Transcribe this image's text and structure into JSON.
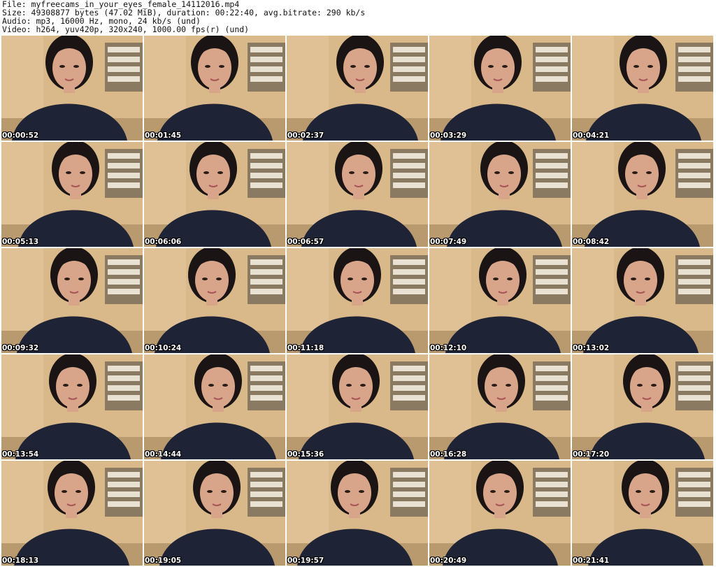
{
  "header": {
    "file": "File: myfreecams_in_your_eyes_female_14112016.mp4",
    "size": "Size: 49308877 bytes (47.02 MiB), duration: 00:22:40, avg.bitrate: 290 kb/s",
    "audio": "Audio: mp3, 16000 Hz, mono, 24 kb/s (und)",
    "video": "Video: h264, yuv420p, 320x240, 1000.00 fps(r) (und)"
  },
  "thumbnails": [
    {
      "timestamp": "00:00:52"
    },
    {
      "timestamp": "00:01:45"
    },
    {
      "timestamp": "00:02:37"
    },
    {
      "timestamp": "00:03:29"
    },
    {
      "timestamp": "00:04:21"
    },
    {
      "timestamp": "00:05:13"
    },
    {
      "timestamp": "00:06:06"
    },
    {
      "timestamp": "00:06:57"
    },
    {
      "timestamp": "00:07:49"
    },
    {
      "timestamp": "00:08:42"
    },
    {
      "timestamp": "00:09:32"
    },
    {
      "timestamp": "00:10:24"
    },
    {
      "timestamp": "00:11:18"
    },
    {
      "timestamp": "00:12:10"
    },
    {
      "timestamp": "00:13:02"
    },
    {
      "timestamp": "00:13:54"
    },
    {
      "timestamp": "00:14:44"
    },
    {
      "timestamp": "00:15:36"
    },
    {
      "timestamp": "00:16:28"
    },
    {
      "timestamp": "00:17:20"
    },
    {
      "timestamp": "00:18:13"
    },
    {
      "timestamp": "00:19:05"
    },
    {
      "timestamp": "00:19:57"
    },
    {
      "timestamp": "00:20:49"
    },
    {
      "timestamp": "00:21:41"
    }
  ],
  "colors": {
    "wall": "#d9b98a",
    "shelf": "#8a7a62",
    "sweater": "#1e2336",
    "skin": "#d9a58a",
    "hair": "#1a1414",
    "table": "#b89a6e"
  }
}
